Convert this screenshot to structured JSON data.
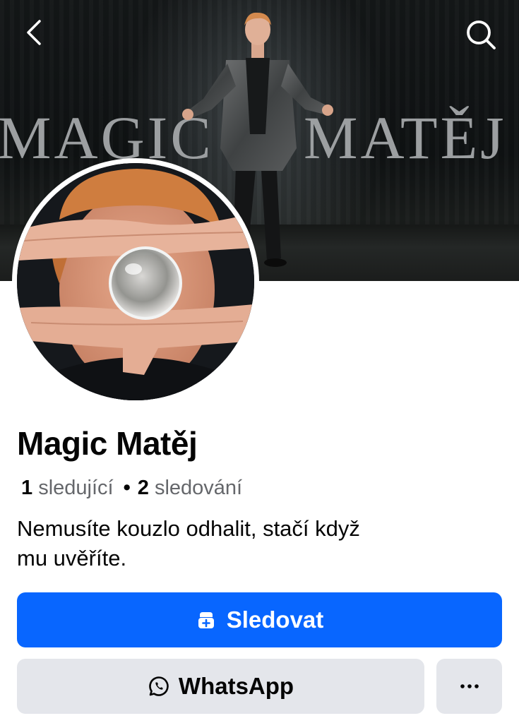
{
  "cover": {
    "title_word_1": "MAGIC",
    "title_word_2": "MATĚJ"
  },
  "header": {
    "back_icon": "chevron-left-icon",
    "search_icon": "search-icon"
  },
  "profile": {
    "name": "Magic Matěj",
    "followers_count": "1",
    "followers_label": "sledující",
    "separator": "•",
    "following_count": "2",
    "following_label": "sledování",
    "bio_line_1": "Nemusíte kouzlo odhalit, stačí když",
    "bio_line_2": "mu uvěříte."
  },
  "actions": {
    "follow_label": "Sledovat",
    "follow_icon": "follow-user-icon",
    "whatsapp_label": "WhatsApp",
    "whatsapp_icon": "whatsapp-icon",
    "more_icon": "more-icon"
  },
  "colors": {
    "accent": "#0866ff",
    "secondary_button": "#e4e6eb",
    "muted_text": "#65676b"
  }
}
